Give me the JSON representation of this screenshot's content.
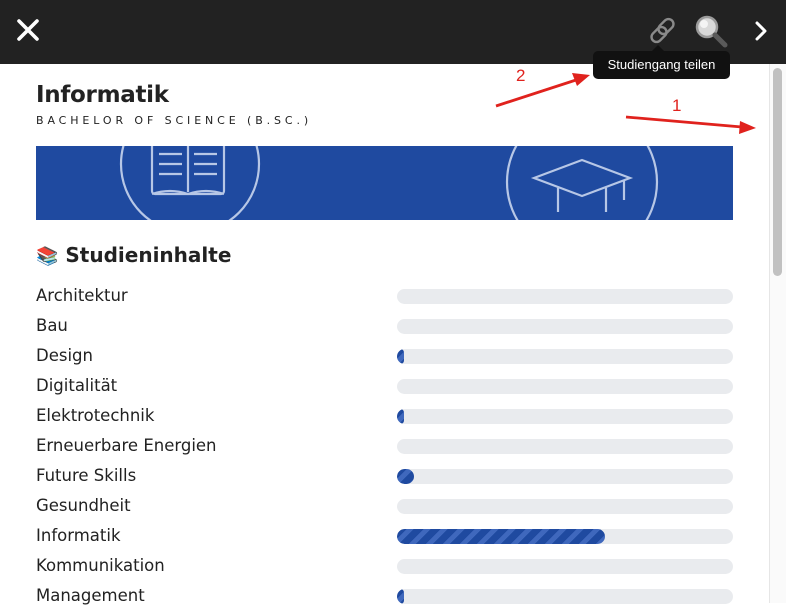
{
  "toolbar": {
    "close_icon": "close-icon",
    "share_icon": "link-icon",
    "search_icon": "magnifier-icon",
    "next_icon": "chevron-right-icon",
    "tooltip": "Studiengang teilen"
  },
  "course": {
    "title": "Informatik",
    "degree": "BACHELOR OF SCIENCE (B.SC.)",
    "banner_color": "#1f4aa0"
  },
  "section": {
    "emoji": "📚",
    "title": "Studieninhalte"
  },
  "topics": [
    {
      "label": "Architektur",
      "level": 0
    },
    {
      "label": "Bau",
      "level": 0
    },
    {
      "label": "Design",
      "level": 0.02
    },
    {
      "label": "Digitalität",
      "level": 0
    },
    {
      "label": "Elektrotechnik",
      "level": 0.02
    },
    {
      "label": "Erneuerbare Energien",
      "level": 0
    },
    {
      "label": "Future Skills",
      "level": 0.05
    },
    {
      "label": "Gesundheit",
      "level": 0
    },
    {
      "label": "Informatik",
      "level": 0.62
    },
    {
      "label": "Kommunikation",
      "level": 0
    },
    {
      "label": "Management",
      "level": 0.02
    }
  ],
  "annotations": [
    {
      "label": "1"
    },
    {
      "label": "2"
    }
  ],
  "colors": {
    "topbar": "#222222",
    "accent": "#1f4aa0",
    "annotation": "#e0221d",
    "track": "#e9ebee"
  }
}
